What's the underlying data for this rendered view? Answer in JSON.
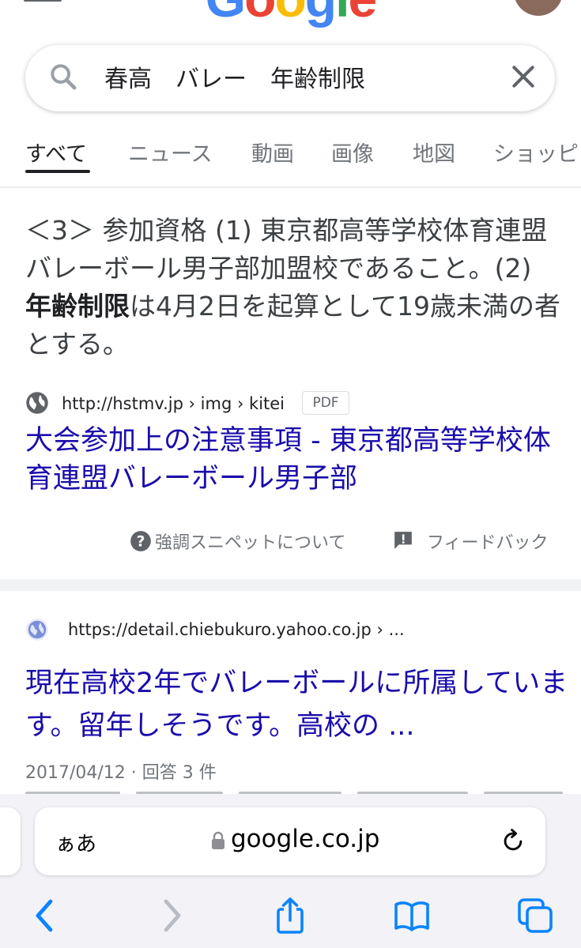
{
  "logo": {
    "letters": [
      "G",
      "o",
      "o",
      "g",
      "l",
      "e"
    ],
    "colors": [
      "#4285F4",
      "#EA4335",
      "#FBBC05",
      "#4285F4",
      "#34A853",
      "#EA4335"
    ]
  },
  "search": {
    "query": "春高　バレー　年齢制限"
  },
  "tabs": [
    {
      "label": "すべて",
      "active": true
    },
    {
      "label": "ニュース",
      "active": false
    },
    {
      "label": "動画",
      "active": false
    },
    {
      "label": "画像",
      "active": false
    },
    {
      "label": "地図",
      "active": false
    },
    {
      "label": "ショッピ",
      "active": false
    }
  ],
  "featured_snippet": {
    "text_before": "＜3＞ 参加資格 (1) 東京都高等学校体育連盟バレーボール男子部加盟校であること。(2) ",
    "text_bold": "年齢制限",
    "text_after": "は4月2日を起算として19歳未満の者とする。",
    "url": "http://hstmv.jp › img › kitei",
    "badge": "PDF",
    "title": "大会参加上の注意事項 - 東京都高等学校体育連盟バレーボール男子部",
    "help_label": "強調スニペットについて",
    "feedback_label": "フィードバック"
  },
  "result2": {
    "url": "https://detail.chiebukuro.yahoo.co.jp › ...",
    "title": "現在高校2年でバレーボールに所属しています。留年しそうです。高校の ...",
    "meta": "2017/04/12 · 回答 3 件"
  },
  "safari": {
    "aa_label": "ぁあ",
    "domain": "google.co.jp",
    "accent": "#0a84ff"
  },
  "colors": {
    "link": "#1a0dab",
    "text": "#202124",
    "muted": "#70757a"
  }
}
